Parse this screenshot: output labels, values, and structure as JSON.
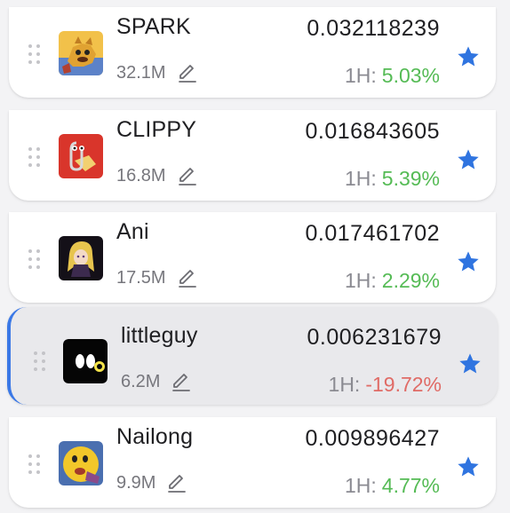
{
  "coins": [
    {
      "name": "SPARK",
      "market_cap": "32.1M",
      "price": "0.032118239",
      "change_label": "1H:",
      "change": "5.03%",
      "direction": "up"
    },
    {
      "name": "CLIPPY",
      "market_cap": "16.8M",
      "price": "0.016843605",
      "change_label": "1H:",
      "change": "5.39%",
      "direction": "up"
    },
    {
      "name": "Ani",
      "market_cap": "17.5M",
      "price": "0.017461702",
      "change_label": "1H:",
      "change": "2.29%",
      "direction": "up"
    },
    {
      "name": "littleguy",
      "market_cap": "6.2M",
      "price": "0.006231679",
      "change_label": "1H:",
      "change": "-19.72%",
      "direction": "down",
      "selected": true
    },
    {
      "name": "Nailong",
      "market_cap": "9.9M",
      "price": "0.009896427",
      "change_label": "1H:",
      "change": "4.77%",
      "direction": "up"
    }
  ],
  "icons": {
    "drag": "drag-handle-icon",
    "edit": "pencil-icon",
    "favorite": "star-icon"
  },
  "colors": {
    "positive": "#55bb55",
    "negative": "#e06b66",
    "star": "#2f74e0",
    "selected_border": "#3a78e6"
  }
}
